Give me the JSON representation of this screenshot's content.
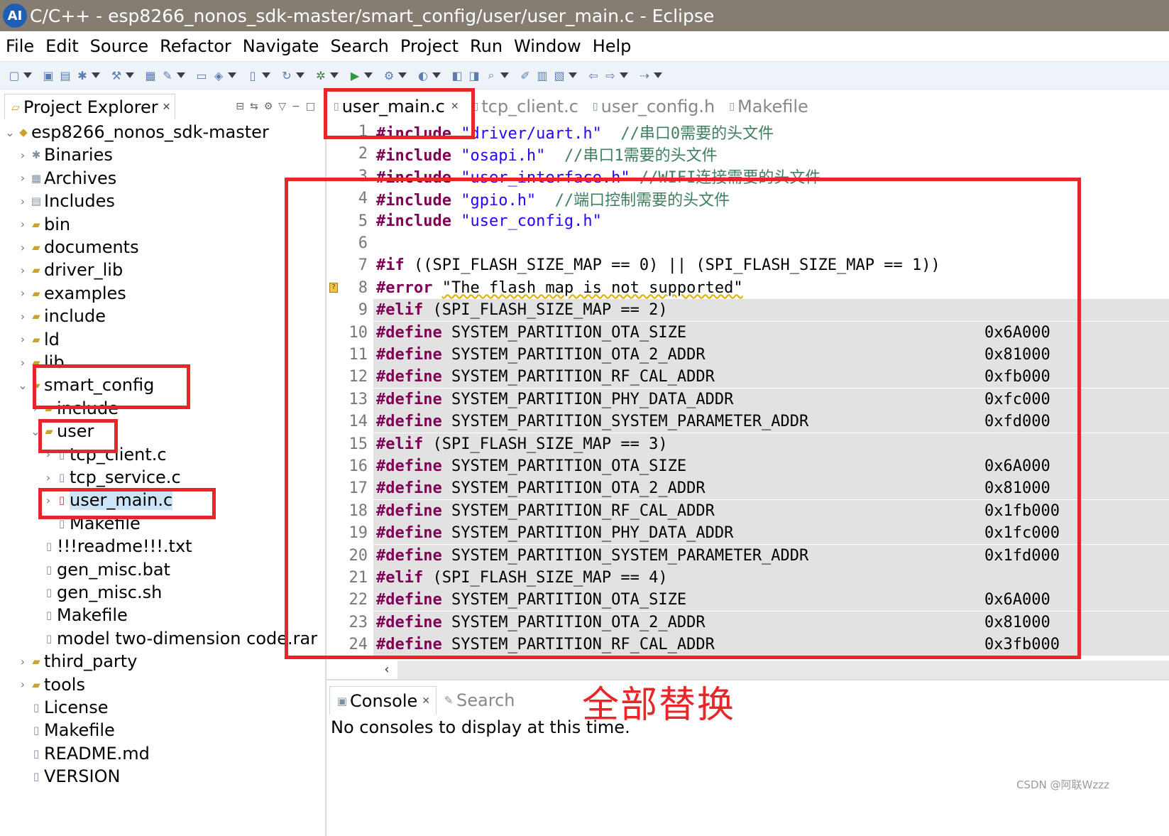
{
  "window": {
    "title": "C/C++ - esp8266_nonos_sdk-master/smart_config/user/user_main.c - Eclipse",
    "logo_text": "AI"
  },
  "menubar": {
    "items": [
      "File",
      "Edit",
      "Source",
      "Refactor",
      "Navigate",
      "Search",
      "Project",
      "Run",
      "Window",
      "Help"
    ]
  },
  "toolbar": {
    "icons": [
      "new-icon",
      "save-icon",
      "save-all-icon",
      "build-config-icon",
      "hammer-build-icon",
      "binary-icon",
      "debug-settings-icon",
      "new-folder-icon",
      "new-class-icon",
      "new-file-icon",
      "refresh-icon",
      "bug-debug-icon",
      "run-icon",
      "external-tools-icon",
      "coverage-icon",
      "open-type-icon",
      "open-task-icon",
      "search-icon",
      "toggle-mark-icon",
      "annotation-icon",
      "next-annotation-icon",
      "back-icon",
      "forward-icon",
      "last-edit-icon"
    ]
  },
  "project_explorer": {
    "title": "Project Explorer",
    "tree": [
      {
        "label": "esp8266_nonos_sdk-master",
        "icon": "project-icon",
        "expanded": true
      },
      {
        "label": "Binaries",
        "icon": "binaries-icon",
        "expanded": false
      },
      {
        "label": "Archives",
        "icon": "archives-icon",
        "expanded": false
      },
      {
        "label": "Includes",
        "icon": "includes-icon",
        "expanded": false
      },
      {
        "label": "bin",
        "icon": "folder-icon",
        "expanded": false
      },
      {
        "label": "documents",
        "icon": "folder-icon",
        "expanded": false
      },
      {
        "label": "driver_lib",
        "icon": "folder-icon",
        "expanded": false
      },
      {
        "label": "examples",
        "icon": "folder-icon",
        "expanded": false
      },
      {
        "label": "include",
        "icon": "folder-icon",
        "expanded": false
      },
      {
        "label": "ld",
        "icon": "folder-icon",
        "expanded": false
      },
      {
        "label": "lib",
        "icon": "folder-icon",
        "expanded": false
      },
      {
        "label": "smart_config",
        "icon": "folder-icon",
        "expanded": true
      },
      {
        "label": "include",
        "icon": "folder-icon",
        "expanded": false
      },
      {
        "label": "user",
        "icon": "folder-icon",
        "expanded": true
      },
      {
        "label": "tcp_client.c",
        "icon": "c-file-icon",
        "expanded": false
      },
      {
        "label": "tcp_service.c",
        "icon": "c-file-icon",
        "expanded": false
      },
      {
        "label": "user_main.c",
        "icon": "c-file-error-icon",
        "expanded": false
      },
      {
        "label": "Makefile",
        "icon": "makefile-icon",
        "expanded": null
      },
      {
        "label": "!!!readme!!!.txt",
        "icon": "text-file-icon",
        "expanded": null
      },
      {
        "label": "gen_misc.bat",
        "icon": "file-icon",
        "expanded": null
      },
      {
        "label": "gen_misc.sh",
        "icon": "file-icon",
        "expanded": null
      },
      {
        "label": "Makefile",
        "icon": "makefile-icon",
        "expanded": null
      },
      {
        "label": "model two-dimension code.rar",
        "icon": "file-icon",
        "expanded": null
      },
      {
        "label": "third_party",
        "icon": "folder-icon",
        "expanded": false
      },
      {
        "label": "tools",
        "icon": "folder-icon",
        "expanded": false
      },
      {
        "label": "License",
        "icon": "file-icon",
        "expanded": null
      },
      {
        "label": "Makefile",
        "icon": "makefile-icon",
        "expanded": null
      },
      {
        "label": "README.md",
        "icon": "markdown-file-icon",
        "expanded": null
      },
      {
        "label": "VERSION",
        "icon": "file-icon",
        "expanded": null
      }
    ]
  },
  "editor": {
    "tabs": [
      {
        "label": "user_main.c",
        "active": true
      },
      {
        "label": "tcp_client.c",
        "active": false
      },
      {
        "label": "user_config.h",
        "active": false
      },
      {
        "label": "Makefile",
        "active": false
      }
    ],
    "lines": [
      {
        "n": "1",
        "parts": [
          [
            "kw",
            "#include "
          ],
          [
            "str",
            "\"driver/uart.h\""
          ],
          [
            "txt",
            "  "
          ],
          [
            "cm",
            "//串口0需要的头文件"
          ]
        ]
      },
      {
        "n": "2",
        "parts": [
          [
            "kw",
            "#include "
          ],
          [
            "str",
            "\"osapi.h\""
          ],
          [
            "txt",
            "  "
          ],
          [
            "cm",
            "//串口1需要的头文件"
          ]
        ]
      },
      {
        "n": "3",
        "parts": [
          [
            "kw",
            "#include "
          ],
          [
            "str",
            "\"user_interface.h\""
          ],
          [
            "txt",
            " "
          ],
          [
            "cm",
            "//WIFI连接需要的头文件"
          ]
        ]
      },
      {
        "n": "4",
        "parts": [
          [
            "kw",
            "#include "
          ],
          [
            "str",
            "\"gpio.h\""
          ],
          [
            "txt",
            "  "
          ],
          [
            "cm",
            "//端口控制需要的头文件"
          ]
        ]
      },
      {
        "n": "5",
        "parts": [
          [
            "kw",
            "#include "
          ],
          [
            "str",
            "\"user_config.h\""
          ]
        ]
      },
      {
        "n": "6",
        "parts": []
      },
      {
        "n": "7",
        "parts": [
          [
            "kw",
            "#if "
          ],
          [
            "txt",
            "((SPI_FLASH_SIZE_MAP == 0) || (SPI_FLASH_SIZE_MAP == 1))"
          ]
        ]
      },
      {
        "n": "8",
        "parts": [
          [
            "kw",
            "#error "
          ],
          [
            "err",
            "\"The flash map is not supported\""
          ]
        ],
        "marker": true
      },
      {
        "n": "9",
        "parts": [
          [
            "kw",
            "#elif "
          ],
          [
            "txt",
            "(SPI_FLASH_SIZE_MAP == 2)"
          ]
        ],
        "inactive": true
      },
      {
        "n": "10",
        "parts": [
          [
            "kw",
            "#define "
          ],
          [
            "txt",
            "SYSTEM_PARTITION_OTA_SIZE"
          ]
        ],
        "hex": "0x6A000",
        "inactive": true
      },
      {
        "n": "11",
        "parts": [
          [
            "kw",
            "#define "
          ],
          [
            "txt",
            "SYSTEM_PARTITION_OTA_2_ADDR"
          ]
        ],
        "hex": "0x81000",
        "inactive": true
      },
      {
        "n": "12",
        "parts": [
          [
            "kw",
            "#define "
          ],
          [
            "txt",
            "SYSTEM_PARTITION_RF_CAL_ADDR"
          ]
        ],
        "hex": "0xfb000",
        "inactive": true
      },
      {
        "n": "13",
        "parts": [
          [
            "kw",
            "#define "
          ],
          [
            "txt",
            "SYSTEM_PARTITION_PHY_DATA_ADDR"
          ]
        ],
        "hex": "0xfc000",
        "inactive": true
      },
      {
        "n": "14",
        "parts": [
          [
            "kw",
            "#define "
          ],
          [
            "txt",
            "SYSTEM_PARTITION_SYSTEM_PARAMETER_ADDR"
          ]
        ],
        "hex": "0xfd000",
        "inactive": true
      },
      {
        "n": "15",
        "parts": [
          [
            "kw",
            "#elif "
          ],
          [
            "txt",
            "(SPI_FLASH_SIZE_MAP == 3)"
          ]
        ],
        "inactive": true
      },
      {
        "n": "16",
        "parts": [
          [
            "kw",
            "#define "
          ],
          [
            "txt",
            "SYSTEM_PARTITION_OTA_SIZE"
          ]
        ],
        "hex": "0x6A000",
        "inactive": true
      },
      {
        "n": "17",
        "parts": [
          [
            "kw",
            "#define "
          ],
          [
            "txt",
            "SYSTEM_PARTITION_OTA_2_ADDR"
          ]
        ],
        "hex": "0x81000",
        "inactive": true
      },
      {
        "n": "18",
        "parts": [
          [
            "kw",
            "#define "
          ],
          [
            "txt",
            "SYSTEM_PARTITION_RF_CAL_ADDR"
          ]
        ],
        "hex": "0x1fb000",
        "inactive": true
      },
      {
        "n": "19",
        "parts": [
          [
            "kw",
            "#define "
          ],
          [
            "txt",
            "SYSTEM_PARTITION_PHY_DATA_ADDR"
          ]
        ],
        "hex": "0x1fc000",
        "inactive": true
      },
      {
        "n": "20",
        "parts": [
          [
            "kw",
            "#define "
          ],
          [
            "txt",
            "SYSTEM_PARTITION_SYSTEM_PARAMETER_ADDR"
          ]
        ],
        "hex": "0x1fd000",
        "inactive": true
      },
      {
        "n": "21",
        "parts": [
          [
            "kw",
            "#elif "
          ],
          [
            "txt",
            "(SPI_FLASH_SIZE_MAP == 4)"
          ]
        ],
        "inactive": true
      },
      {
        "n": "22",
        "parts": [
          [
            "kw",
            "#define "
          ],
          [
            "txt",
            "SYSTEM_PARTITION_OTA_SIZE"
          ]
        ],
        "hex": "0x6A000",
        "inactive": true
      },
      {
        "n": "23",
        "parts": [
          [
            "kw",
            "#define "
          ],
          [
            "txt",
            "SYSTEM_PARTITION_OTA_2_ADDR"
          ]
        ],
        "hex": "0x81000",
        "inactive": true
      },
      {
        "n": "24",
        "parts": [
          [
            "kw",
            "#define "
          ],
          [
            "txt",
            "SYSTEM_PARTITION_RF_CAL_ADDR"
          ]
        ],
        "hex": "0x3fb000",
        "inactive": true
      }
    ]
  },
  "console": {
    "tabs": [
      {
        "label": "Console",
        "active": true
      },
      {
        "label": "Search",
        "active": false
      }
    ],
    "message": "No consoles to display at this time."
  },
  "annotation": "全部替换",
  "watermark": "CSDN @阿联Wzzz",
  "colors": {
    "title_bar": "#857c72",
    "highlight_red": "#e8262a",
    "keyword": "#7f0055",
    "string": "#2a00ff",
    "comment": "#3f7f5f",
    "inactive_code_bg": "#e2e2e2"
  }
}
